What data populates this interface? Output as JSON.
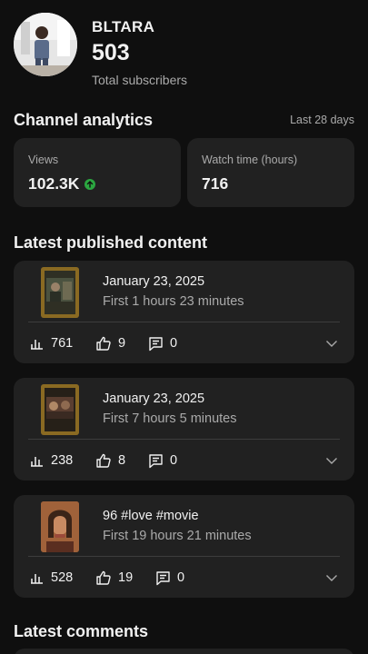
{
  "channel": {
    "name": "BLTARA",
    "subscribers": "503",
    "subscribers_label": "Total subscribers"
  },
  "analytics": {
    "title": "Channel analytics",
    "period": "Last 28 days",
    "metrics": [
      {
        "label": "Views",
        "value": "102.3K",
        "trend_icon": "arrow-up-icon"
      },
      {
        "label": "Watch time (hours)",
        "value": "716"
      }
    ]
  },
  "latest_content": {
    "title": "Latest published content",
    "items": [
      {
        "title": "January 23, 2025",
        "subtitle": "First 1 hours 23 minutes",
        "views": "761",
        "likes": "9",
        "comments": "0"
      },
      {
        "title": "January 23, 2025",
        "subtitle": "First 7 hours 5 minutes",
        "views": "238",
        "likes": "8",
        "comments": "0"
      },
      {
        "title": "96 #love #movie",
        "subtitle": "First 19 hours 21 minutes",
        "views": "528",
        "likes": "19",
        "comments": "0"
      }
    ]
  },
  "latest_comments": {
    "title": "Latest comments"
  },
  "colors": {
    "background": "#0f0f0f",
    "card": "#212121",
    "secondary_text": "#aaaaaa",
    "trend_up": "#2ba640"
  }
}
